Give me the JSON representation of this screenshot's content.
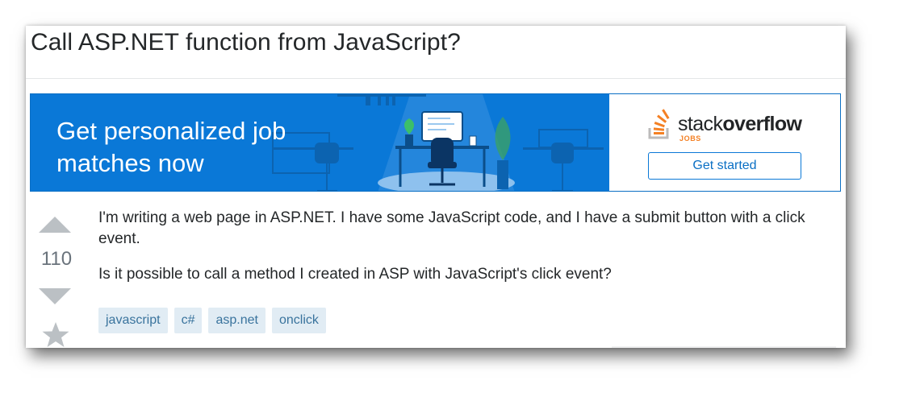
{
  "question": {
    "title": "Call ASP.NET function from JavaScript?",
    "votes": "110",
    "paragraphs": [
      "I'm writing a web page in ASP.NET. I have some JavaScript code, and I have a submit button with a click event.",
      "Is it possible to call a method I created in ASP with JavaScript's click event?"
    ],
    "tags": [
      "javascript",
      "c#",
      "asp.net",
      "onclick"
    ]
  },
  "banner": {
    "headline": "Get personalized job matches now",
    "brand_regular": "stack",
    "brand_bold": "overflow",
    "brand_sub": "JOBS",
    "cta_label": "Get started",
    "colors": {
      "background": "#0a78d7",
      "accent": "#f48024"
    }
  },
  "icons": {
    "upvote": "upvote-arrow-icon",
    "downvote": "downvote-arrow-icon",
    "favorite": "star-icon",
    "logo": "stack-overflow-logo-icon"
  }
}
